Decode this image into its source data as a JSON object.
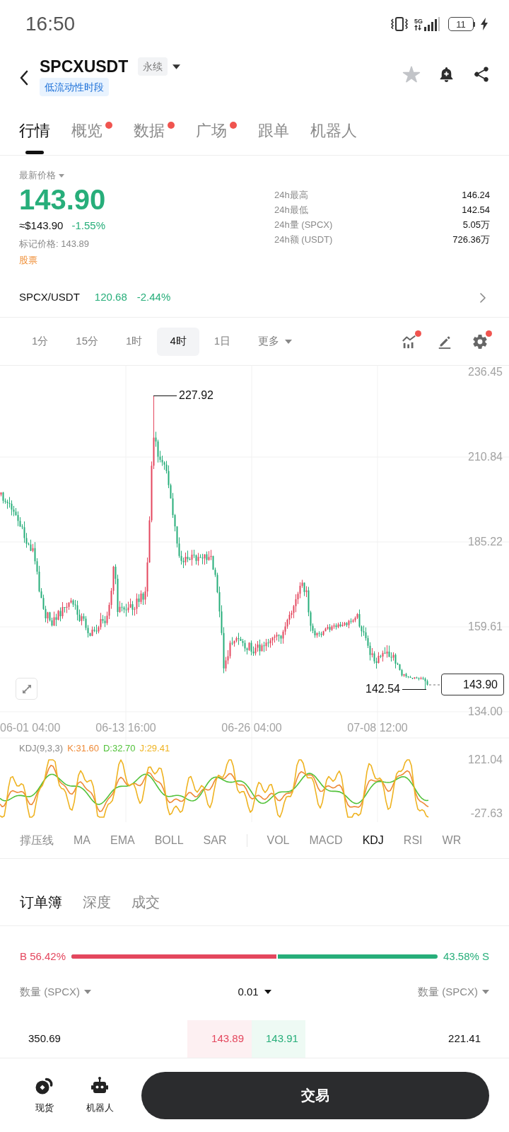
{
  "status_bar": {
    "time": "16:50",
    "network": "5G",
    "battery": "11"
  },
  "header": {
    "symbol": "SPCXUSDT",
    "contract_badge": "永续",
    "notice_tag": "低流动性时段",
    "favorited": false
  },
  "tabs": [
    {
      "label": "行情",
      "selected": true,
      "dot": false
    },
    {
      "label": "概览",
      "selected": false,
      "dot": true
    },
    {
      "label": "数据",
      "selected": false,
      "dot": true
    },
    {
      "label": "广场",
      "selected": false,
      "dot": true
    },
    {
      "label": "跟单",
      "selected": false,
      "dot": false
    },
    {
      "label": "机器人",
      "selected": false,
      "dot": false
    }
  ],
  "price": {
    "label": "最新价格",
    "last": "143.90",
    "usd": "≈$143.90",
    "change": "-1.55%",
    "mark_price": "标记价格: 143.89",
    "category": "股票"
  },
  "stats": [
    {
      "label": "24h最高",
      "value": "146.24"
    },
    {
      "label": "24h最低",
      "value": "142.54"
    },
    {
      "label": "24h量 (SPCX)",
      "value": "5.05万"
    },
    {
      "label": "24h额 (USDT)",
      "value": "726.36万"
    }
  ],
  "spot_pair": {
    "name": "SPCX/USDT",
    "price": "120.68",
    "change": "-2.44%"
  },
  "intervals": [
    {
      "label": "1分",
      "selected": false
    },
    {
      "label": "15分",
      "selected": false
    },
    {
      "label": "1时",
      "selected": false
    },
    {
      "label": "4时",
      "selected": true
    },
    {
      "label": "1日",
      "selected": false
    }
  ],
  "more_intervals": "更多",
  "chart_tools": [
    {
      "kind": "indicators",
      "dot": true
    },
    {
      "kind": "draw",
      "dot": false
    },
    {
      "kind": "settings",
      "dot": true
    }
  ],
  "price_chart": {
    "y_axis_labels": [
      "236.45",
      "210.84",
      "185.22",
      "159.61",
      "134.00"
    ],
    "x_axis_labels": [
      "06-01 04:00",
      "06-13 16:00",
      "06-26 04:00",
      "07-08 12:00"
    ],
    "high_label": "227.92",
    "low_label": "142.54",
    "current_price": "143.90"
  },
  "kdj": {
    "name": "KDJ(9,3,3)",
    "readings": [
      {
        "text": "K:31.60",
        "color": "#ee8a37"
      },
      {
        "text": "D:32.70",
        "color": "#52c23a"
      },
      {
        "text": "J:29.41",
        "color": "#efb321"
      }
    ],
    "y_axis_labels": [
      "121.04",
      "-27.63"
    ]
  },
  "indicators": {
    "main": [
      {
        "label": "撑压线",
        "selected": false
      },
      {
        "label": "MA",
        "selected": false
      },
      {
        "label": "EMA",
        "selected": false
      },
      {
        "label": "BOLL",
        "selected": false
      },
      {
        "label": "SAR",
        "selected": false
      }
    ],
    "sub": [
      {
        "label": "VOL",
        "selected": false
      },
      {
        "label": "MACD",
        "selected": false
      },
      {
        "label": "KDJ",
        "selected": true
      },
      {
        "label": "RSI",
        "selected": false
      },
      {
        "label": "WR",
        "selected": false
      }
    ]
  },
  "order_book": {
    "tabs": [
      {
        "label": "订单簿",
        "selected": true
      },
      {
        "label": "深度",
        "selected": false
      },
      {
        "label": "成交",
        "selected": false
      }
    ],
    "buy_share": "B 56.42%",
    "sell_share": "43.58% S",
    "ratio_bar": {
      "level": 0.5642
    },
    "columns": {
      "bid_amount": "数量 (SPCX)",
      "precision": "0.01",
      "ask_amount": "数量 (SPCX)"
    },
    "rows": [
      {
        "bid_amount": "350.69",
        "bid_price": "143.89",
        "ask_price": "143.91",
        "ask_amount": "221.41"
      }
    ]
  },
  "bottom_nav": {
    "items": [
      {
        "label": "现货",
        "kind": "spot"
      },
      {
        "label": "机器人",
        "kind": "robot"
      }
    ],
    "trade_button": "交易"
  }
}
